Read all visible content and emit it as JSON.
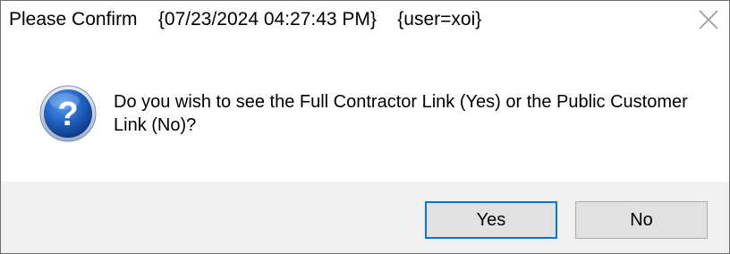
{
  "window": {
    "title": "Please Confirm    {07/23/2024 04:27:43 PM}    {user=xoi}"
  },
  "titlebar": {
    "close_icon": "close-icon"
  },
  "message": {
    "icon": "question-icon",
    "text": "Do you wish to see the Full Contractor Link (Yes) or the Public Customer Link (No)?"
  },
  "buttons": {
    "yes_label": "Yes",
    "no_label": "No",
    "default": "Yes"
  },
  "colors": {
    "icon_blue": "#1f5fb4",
    "footer_bg": "#f0f0f0",
    "focus_border": "#0078d7"
  }
}
